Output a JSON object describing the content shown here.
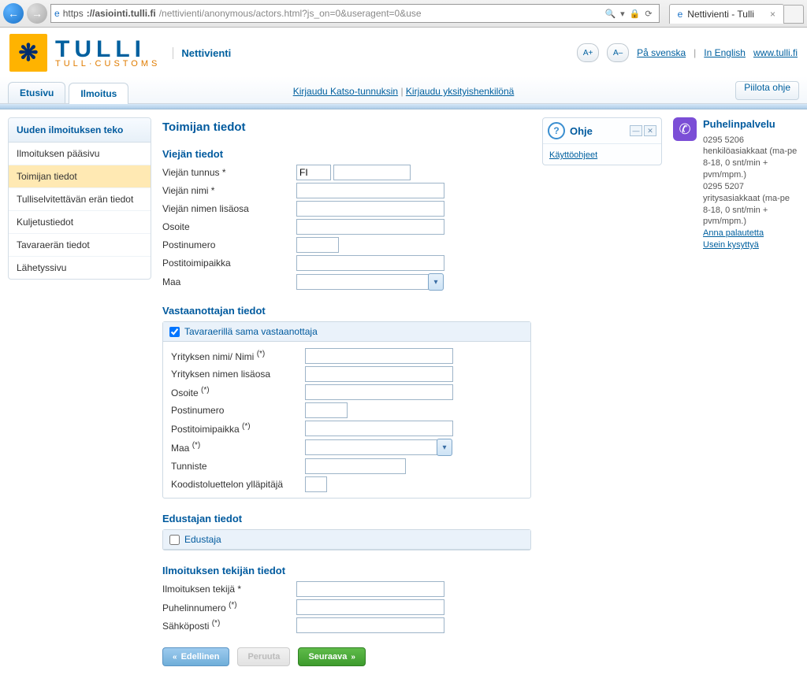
{
  "browser": {
    "url_prefix": "https",
    "url_host": "://asiointi.tulli.fi",
    "url_path": "/nettivienti/anonymous/actors.html?js_on=0&useragent=0&use",
    "search_glyph": "🔍",
    "tab_title": "Nettivienti - Tulli"
  },
  "header": {
    "logo_symbol": "❋",
    "logo_line1": "TULLI",
    "logo_line2": "TULL·CUSTOMS",
    "app_name": "Nettivienti",
    "font_plus": "A+",
    "font_minus": "A–",
    "lang_sv": "På svenska",
    "lang_en": "In English",
    "home_link": "www.tulli.fi"
  },
  "tabs": {
    "etusivu": "Etusivu",
    "ilmoitus": "Ilmoitus",
    "login_katso": "Kirjaudu Katso-tunnuksin",
    "login_person": "Kirjaudu yksityishenkilönä",
    "piilota": "Piilota ohje"
  },
  "sidebar": {
    "title": "Uuden ilmoituksen teko",
    "items": [
      {
        "label": "Ilmoituksen pääsivu"
      },
      {
        "label": "Toimijan tiedot"
      },
      {
        "label": "Tulliselvitettävän erän tiedot"
      },
      {
        "label": "Kuljetustiedot"
      },
      {
        "label": "Tavaraerän tiedot"
      },
      {
        "label": "Lähetyssivu"
      }
    ]
  },
  "content": {
    "page_title": "Toimijan tiedot",
    "viejan": {
      "heading": "Viejän tiedot",
      "tunnus_lbl": "Viejän tunnus *",
      "tunnus_val": "FI",
      "nimi_lbl": "Viejän nimi *",
      "nimen_lisa_lbl": "Viejän nimen lisäosa",
      "osoite_lbl": "Osoite",
      "postinr_lbl": "Postinumero",
      "postitp_lbl": "Postitoimipaikka",
      "maa_lbl": "Maa"
    },
    "vastaanottaja": {
      "heading": "Vastaanottajan tiedot",
      "checkbox_lbl": "Tavaraerillä sama vastaanottaja",
      "yritys_lbl": "Yrityksen nimi/ Nimi",
      "yritys_lisa_lbl": "Yrityksen nimen lisäosa",
      "osoite_lbl": "Osoite",
      "postinr_lbl": "Postinumero",
      "postitp_lbl": "Postitoimipaikka",
      "maa_lbl": "Maa",
      "tunniste_lbl": "Tunniste",
      "koodisto_lbl": "Koodistoluettelon ylläpitäjä"
    },
    "edustaja": {
      "heading": "Edustajan tiedot",
      "checkbox_lbl": "Edustaja"
    },
    "ilmoittaja": {
      "heading": "Ilmoituksen tekijän tiedot",
      "tekija_lbl": "Ilmoituksen tekijä *",
      "puh_lbl": "Puhelinnumero",
      "email_lbl": "Sähköposti"
    },
    "buttons": {
      "prev": "Edellinen",
      "cancel": "Peruuta",
      "next": "Seuraava"
    },
    "star_note": "(*)"
  },
  "help": {
    "title": "Ohje",
    "link": "Käyttöohjeet"
  },
  "phone": {
    "title": "Puhelinpalvelu",
    "line1": "0295 5206 henkilöasiakkaat (ma-pe 8-18, 0 snt/min + pvm/mpm.)",
    "line2": "0295 5207 yritysasiakkaat (ma-pe 8-18, 0 snt/min + pvm/mpm.)",
    "link1": "Anna palautetta",
    "link2": "Usein kysyttyä"
  }
}
